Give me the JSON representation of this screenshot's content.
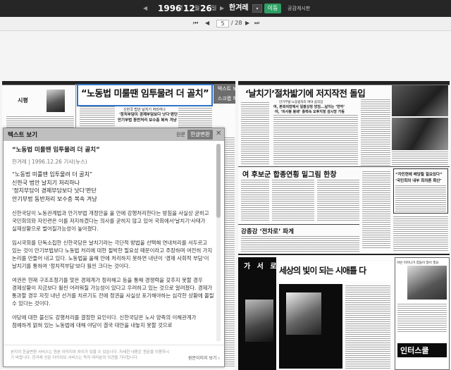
{
  "topbar": {
    "prev_symbol": "◀",
    "year": "1996",
    "month": "12",
    "day": "26",
    "next_symbol": "▶",
    "paper": "한겨레",
    "dropdown_symbol": "▾",
    "go_label": "이동",
    "board_label": "공감게시판"
  },
  "pagenav": {
    "first_symbol": "⏮",
    "prev_symbol": "◀",
    "current_page": "5",
    "total": "/ 28",
    "next_symbol": "▶",
    "last_symbol": "⏭"
  },
  "newspaper": {
    "left": {
      "column_name": "시평",
      "headline": "“노동법 미룰땐 임투물려 더 골치”",
      "sub1": "신한국 법안 날치기 처리하나",
      "sub2": "'정치부담이 경제부담보다 낫다'판단",
      "sub3": "안기부법 동반처리 보수층 복속 겨냥",
      "btn_text": "텍스트 보기",
      "btn_scrap": "스크랩 하기"
    },
    "right": {
      "headline": "‘날치기’절차밟기에 저지작전 돌입",
      "sub1": "안기부법‧노동법처리 여야 움직임",
      "sub2": "여, 본회의장에서 일괄상정 방침...날치는 ‘연막’",
      "sub3": "야, ‘의사봉 봉쇄’ 총력속 오후지정 감시망 가동",
      "headline2": "여 후보군 합종연횡 밑그림 한창",
      "headline3": "강종강 ‘전차로’ 파게",
      "sidebar1": "“자민련에 배당될 필요있다”",
      "sidebar2": "‘국민회의 내부 회의론 확산’",
      "ad_text": "세상의 빛이 되는 시애틀 다",
      "ad_book": "가 서 로 천 사",
      "ad_logo": "인터스쿨",
      "ad_small": "이런 어머니가 힘들이 많이 필요"
    }
  },
  "panel": {
    "title": "텍스트 보기",
    "original_label": "원문",
    "hangul_btn": "한글변환",
    "close_symbol": "✕",
    "article_title": "“노동법 미룰땐 임투물려 더 골치”",
    "meta": "한겨레 | 1996.12.26 기사(뉴스)",
    "deck": [
      "“노동법 미룰땐 임투물려 더 골치”",
      "신한국 법안 날치기 처리하나",
      "'정치부담이 경제부담보다 낫다'판단",
      "안기부법 동반처리 보수층 복속 겨냥"
    ],
    "paragraphs": [
      "신한국당이 노동관계법과 안기부법 개정안을 올 안에 강행처리한다는 방침을 사실상 굳히고 국민회의와 자민련은 이를 저지하겠다는 의사를 굳히지 않고 있어 국회에서'날치기'사태가 실제상황으로 벌어질가능성이 높아졌다.",
      "임시국회를 단독소집한 신한국당은 날치기라는 극단적 방법을 선택해 연내처리를 서두르고 있는 것이 안기부법보다 노동법 처리에 대한 절박한 필요성 때문이라고 주장하며 여전히 가지 논리를 만들어 내고 있다. 노동법을 올해 안에 처리하지 못하면 내년이 '경제 사회적 부담'이 날치기를 통하여 '정치적부담'보다 훨씬 크다는 것이다.",
      "여권은 현재 구조조정기를 맞은 경제계가 정리해고 등을 통해 경쟁력을 갖추지 못할 경우 경제상황이 지금보다 훨씬 어려워질 가능성이 있다고 우려하고 있는 것으로 알려졌다. 경제가 통과할 경우 자칫 내년 선거를 치르기도 전에 정권을 사실상 포기해야하는 심각한 상황에 몰릴 수 있다는 것이다.",
      "야당에 대한 불신도 강행처리를 결정한 요인이다. 신한국당은 노사 양측의 이해관계가 첨예하게 얽혀 있는 노동법에 대해 야당이 결국 대안을 내놓지 못할 것으로"
    ],
    "footer_note": "본지의 한글변환 서비스는 원본 이미지와 차이가 있을 수 있습니다. 자세한 내용은 원문을 이용하시기 바랍니다. 한겨레 신문 아카이브 서비스는 독자 여러분의 의견을 기다립니다.",
    "original_link": "원문이미지 보기 ›"
  }
}
